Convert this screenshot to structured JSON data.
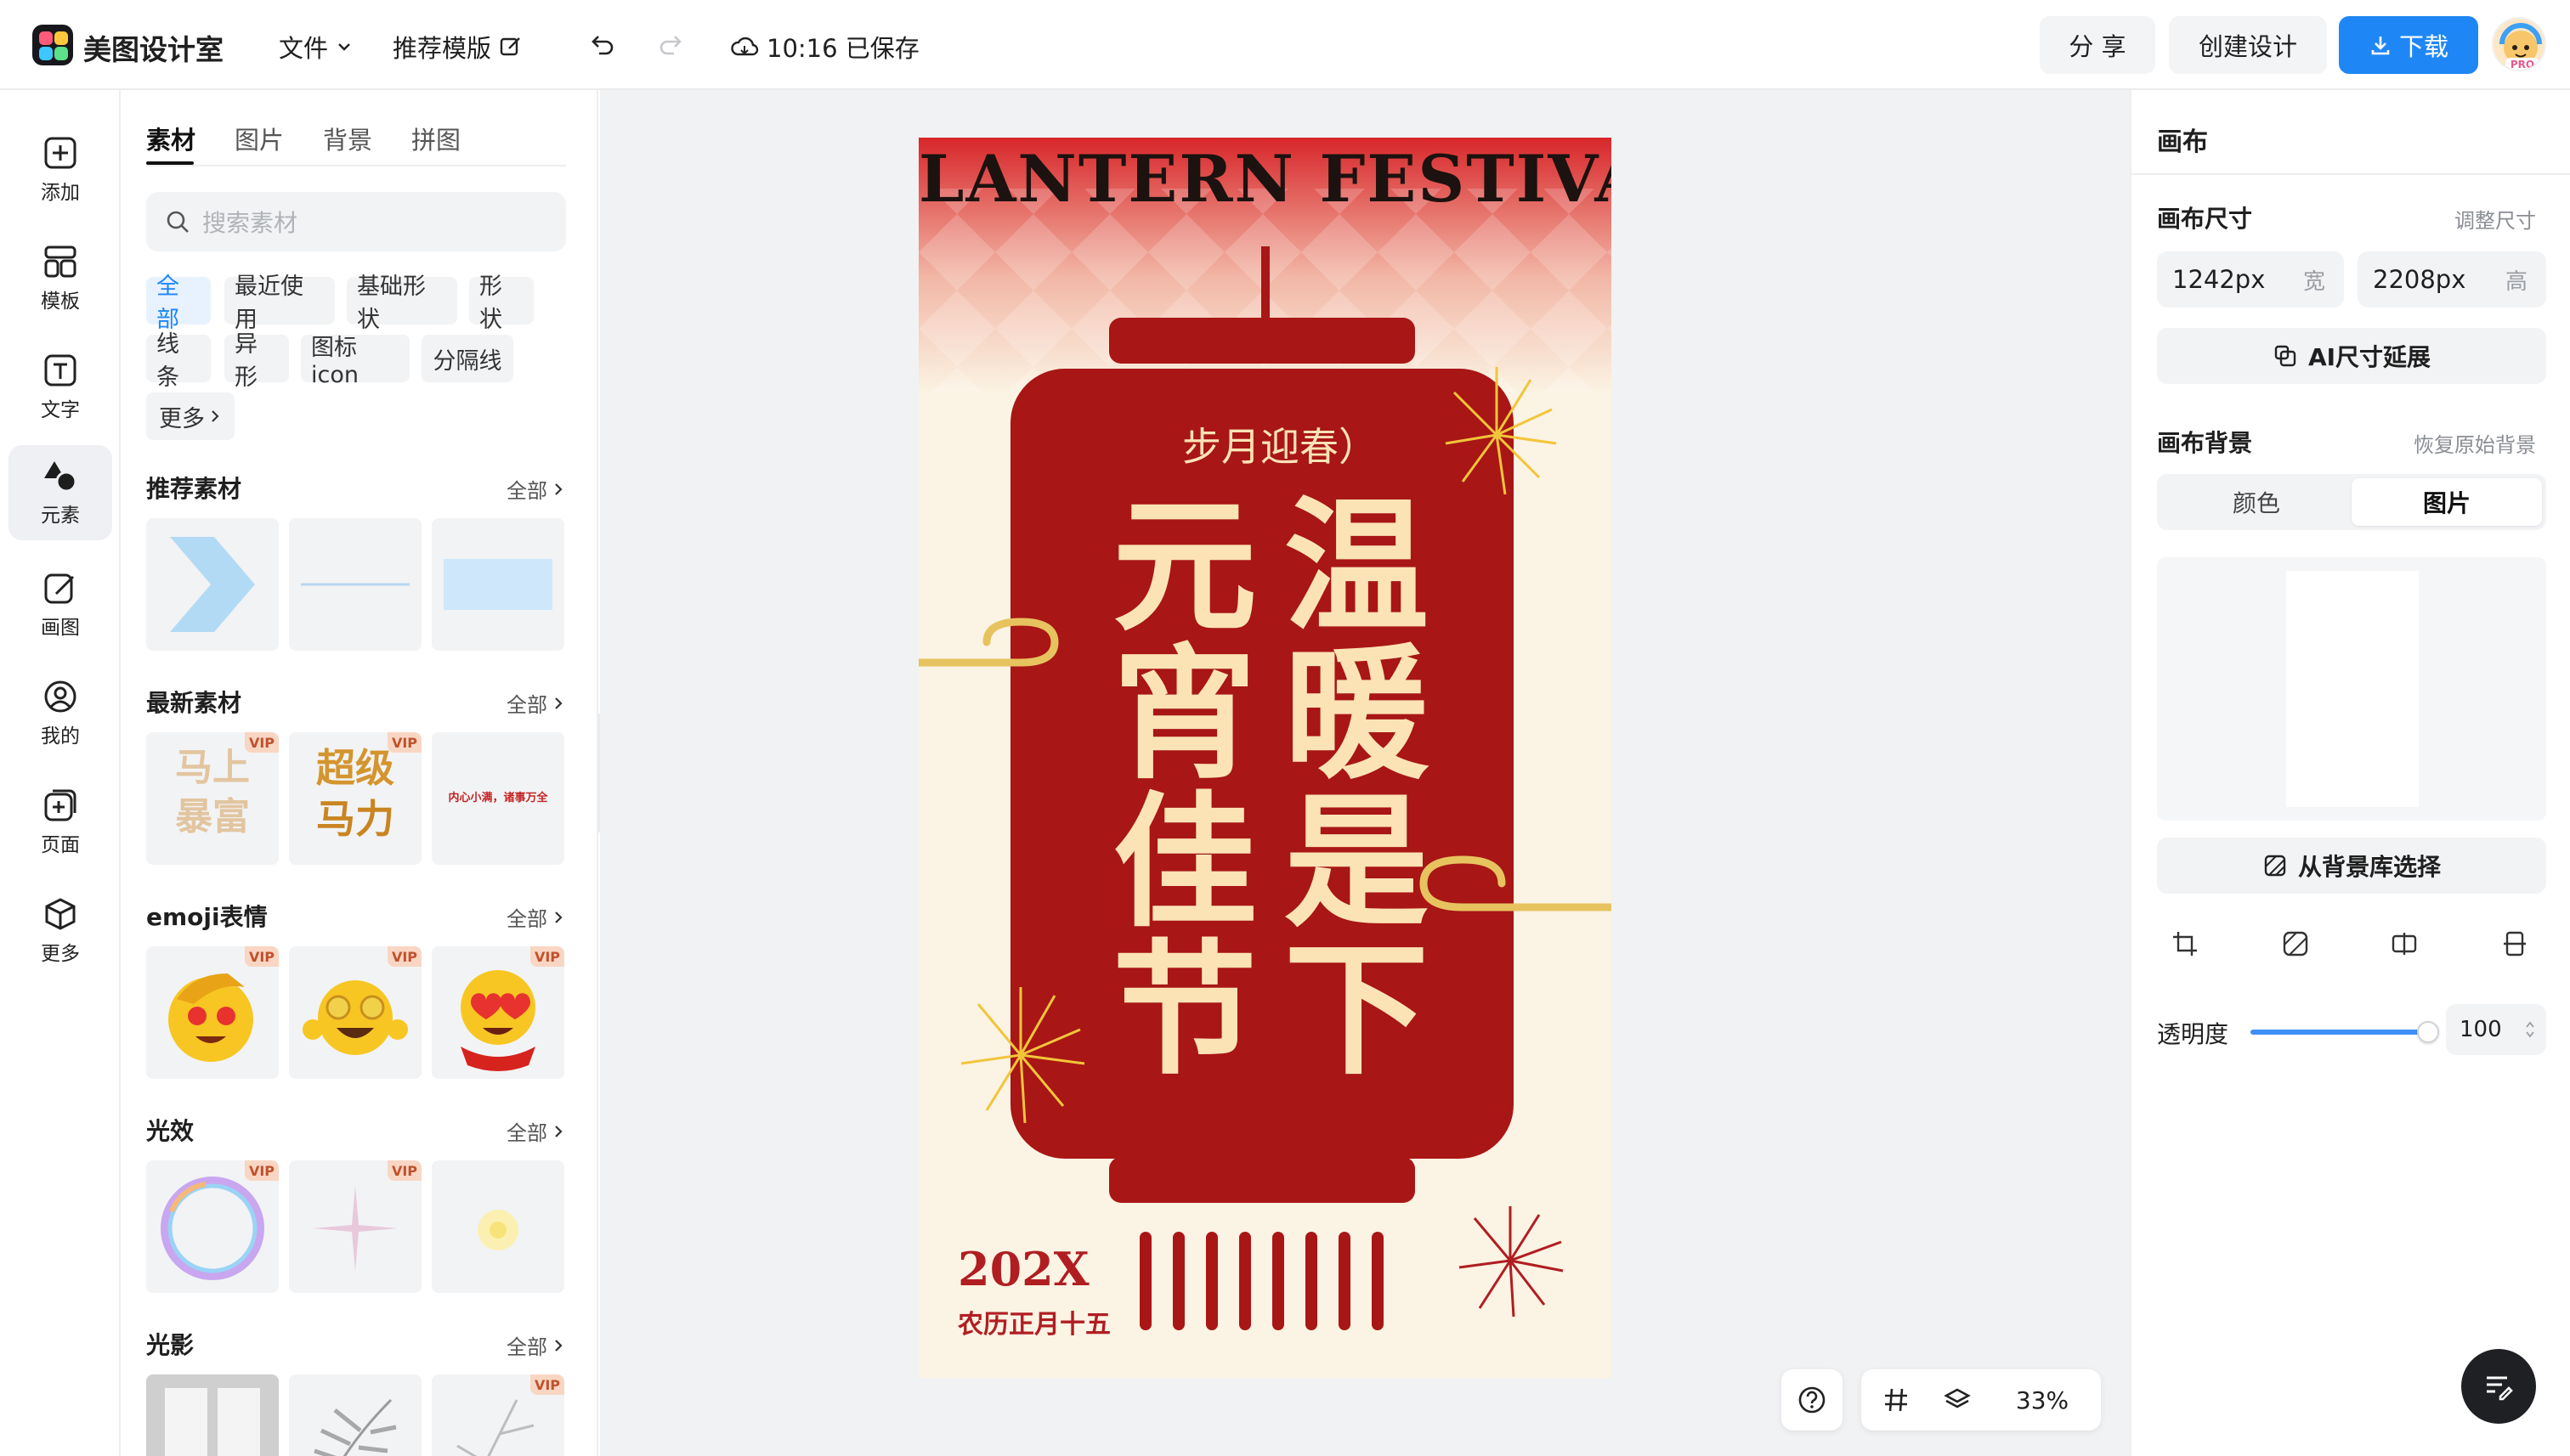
{
  "app": {
    "name": "美图设计室"
  },
  "topbar": {
    "file_menu": "文件",
    "template_menu": "推荐模版",
    "save_status": "10:16 已保存",
    "share": "分 享",
    "create": "创建设计",
    "download": "下载",
    "avatar_badge": "PRO"
  },
  "rail": {
    "items": [
      {
        "label": "添加",
        "icon": "plus-square-icon"
      },
      {
        "label": "模板",
        "icon": "template-grid-icon"
      },
      {
        "label": "文字",
        "icon": "text-icon"
      },
      {
        "label": "元素",
        "icon": "shapes-icon",
        "active": true
      },
      {
        "label": "画图",
        "icon": "pencil-icon"
      },
      {
        "label": "我的",
        "icon": "user-icon"
      },
      {
        "label": "页面",
        "icon": "page-add-icon"
      },
      {
        "label": "更多",
        "icon": "cube-icon"
      }
    ]
  },
  "panel": {
    "tabs": [
      "素材",
      "图片",
      "背景",
      "拼图"
    ],
    "active_tab": "素材",
    "search_placeholder": "搜索素材",
    "chips": [
      "全部",
      "最近使用",
      "基础形状",
      "形状",
      "线条",
      "异形",
      "图标icon",
      "分隔线",
      "更多"
    ],
    "active_chip": "全部",
    "more_label": "全部",
    "vip": "VIP",
    "sections": [
      {
        "title": "推荐素材"
      },
      {
        "title": "最新素材",
        "thumb_texts": [
          "马上",
          "暴富",
          "超级",
          "马力",
          "内心小满，诸事万全"
        ]
      },
      {
        "title": "emoji表情"
      },
      {
        "title": "光效"
      },
      {
        "title": "光影"
      }
    ]
  },
  "poster": {
    "title": "LANTERN  FESTIVAL",
    "subtitle": "步月迎春）",
    "left_column": [
      "元",
      "宵",
      "佳",
      "节"
    ],
    "right_column": [
      "温",
      "暖",
      "是",
      "下"
    ],
    "year": "202X",
    "lunar_date": "农历正月十五"
  },
  "toolbar": {
    "zoom": "33%"
  },
  "right_panel": {
    "title": "画布",
    "size_label": "画布尺寸",
    "resize_link": "调整尺寸",
    "width_value": "1242px",
    "width_unit": "宽",
    "height_value": "2208px",
    "height_unit": "高",
    "ai_extend": "AI尺寸延展",
    "bg_label": "画布背景",
    "restore_link": "恢复原始背景",
    "seg_color": "颜色",
    "seg_image": "图片",
    "from_library": "从背景库选择",
    "opacity_label": "透明度",
    "opacity_value": "100"
  },
  "colors": {
    "accent": "#1f87f5",
    "poster_red": "#a81616",
    "poster_gold": "#fbe3b5",
    "poster_cream": "#fbf3e3"
  }
}
